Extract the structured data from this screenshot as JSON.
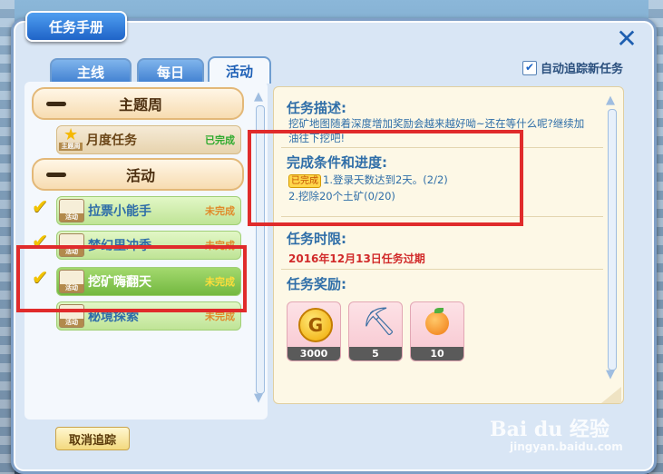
{
  "window": {
    "title": "任务手册"
  },
  "tabs": [
    {
      "label": "主线"
    },
    {
      "label": "每日"
    },
    {
      "label": "活动"
    }
  ],
  "auto_track": {
    "label": "自动追踪新任务",
    "checked": true
  },
  "task_list": {
    "groups": [
      {
        "label": "主题周",
        "tasks": [
          {
            "icon_label": "主题周",
            "name": "月度任务",
            "status": "已完成"
          }
        ]
      },
      {
        "label": "活动",
        "tasks": [
          {
            "icon_label": "活动",
            "name": "拉票小能手",
            "status": "未完成"
          },
          {
            "icon_label": "活动",
            "name": "梦幻里冲季",
            "status": "未完成"
          },
          {
            "icon_label": "活动",
            "name": "挖矿嗨翻天",
            "status": "未完成"
          },
          {
            "icon_label": "活动",
            "name": "秘境探索",
            "status": "未完成"
          }
        ]
      }
    ]
  },
  "details": {
    "description_title": "任务描述:",
    "description": "挖矿地图随着深度增加奖励会越来越好呦~还在等什么呢?继续加油往下挖吧!",
    "conditions_title": "完成条件和进度:",
    "conditions": [
      {
        "badge": "已完成",
        "text": "1.登录天数达到2天。(2/2)"
      },
      {
        "badge": "",
        "text": "2.挖除20个土矿(0/20)"
      }
    ],
    "deadline_title": "任务时限:",
    "deadline": "2016年12月13日任务过期",
    "rewards_title": "任务奖励:",
    "rewards": [
      {
        "icon": "gold-coin-icon",
        "glyph": "G",
        "amount": "3000"
      },
      {
        "icon": "pickaxe-icon",
        "glyph": "⛏",
        "amount": "5"
      },
      {
        "icon": "orange-fruit-icon",
        "glyph": "",
        "amount": "10"
      }
    ]
  },
  "cancel_button": {
    "label": "取消追踪"
  },
  "watermark": {
    "brand": "Bai du 经验",
    "url": "jingyan.baidu.com"
  },
  "colors": {
    "highlight": "#e02b2b",
    "title_blue": "#1f64c8",
    "deadline_red": "#d12a2a"
  }
}
